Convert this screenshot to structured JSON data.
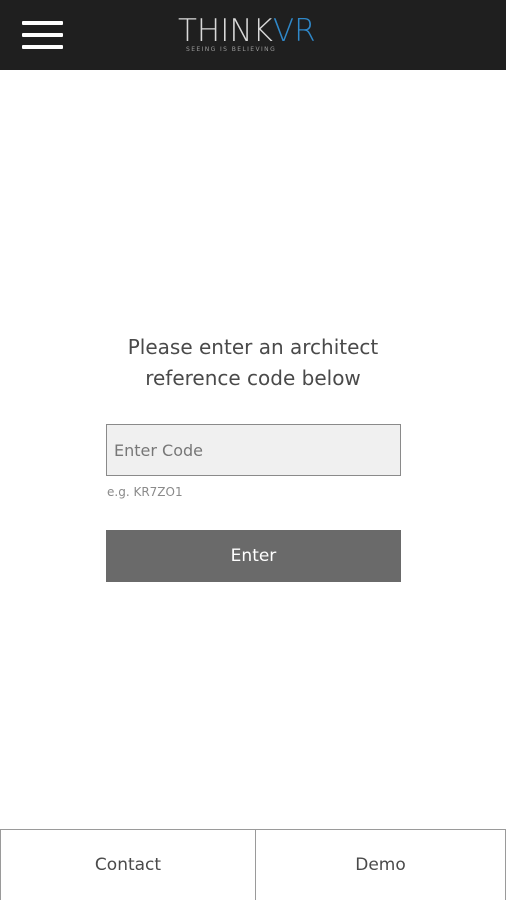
{
  "header": {
    "menu_icon": "hamburger-menu-icon",
    "logo": {
      "think": "THINK",
      "vr": "VR",
      "tagline": "SEEING IS BELIEVING"
    }
  },
  "main": {
    "prompt_line1": "Please enter an architect",
    "prompt_line2": "reference code below",
    "code_input": {
      "placeholder": "Enter Code",
      "value": ""
    },
    "hint": "e.g. KR7ZO1",
    "enter_label": "Enter"
  },
  "footer": {
    "contact_label": "Contact",
    "demo_label": "Demo"
  },
  "colors": {
    "header_bg": "#1f1f1f",
    "logo_accent": "#2f88c9",
    "button_bg": "#6a6a6a",
    "input_bg": "#f0f0f0"
  }
}
